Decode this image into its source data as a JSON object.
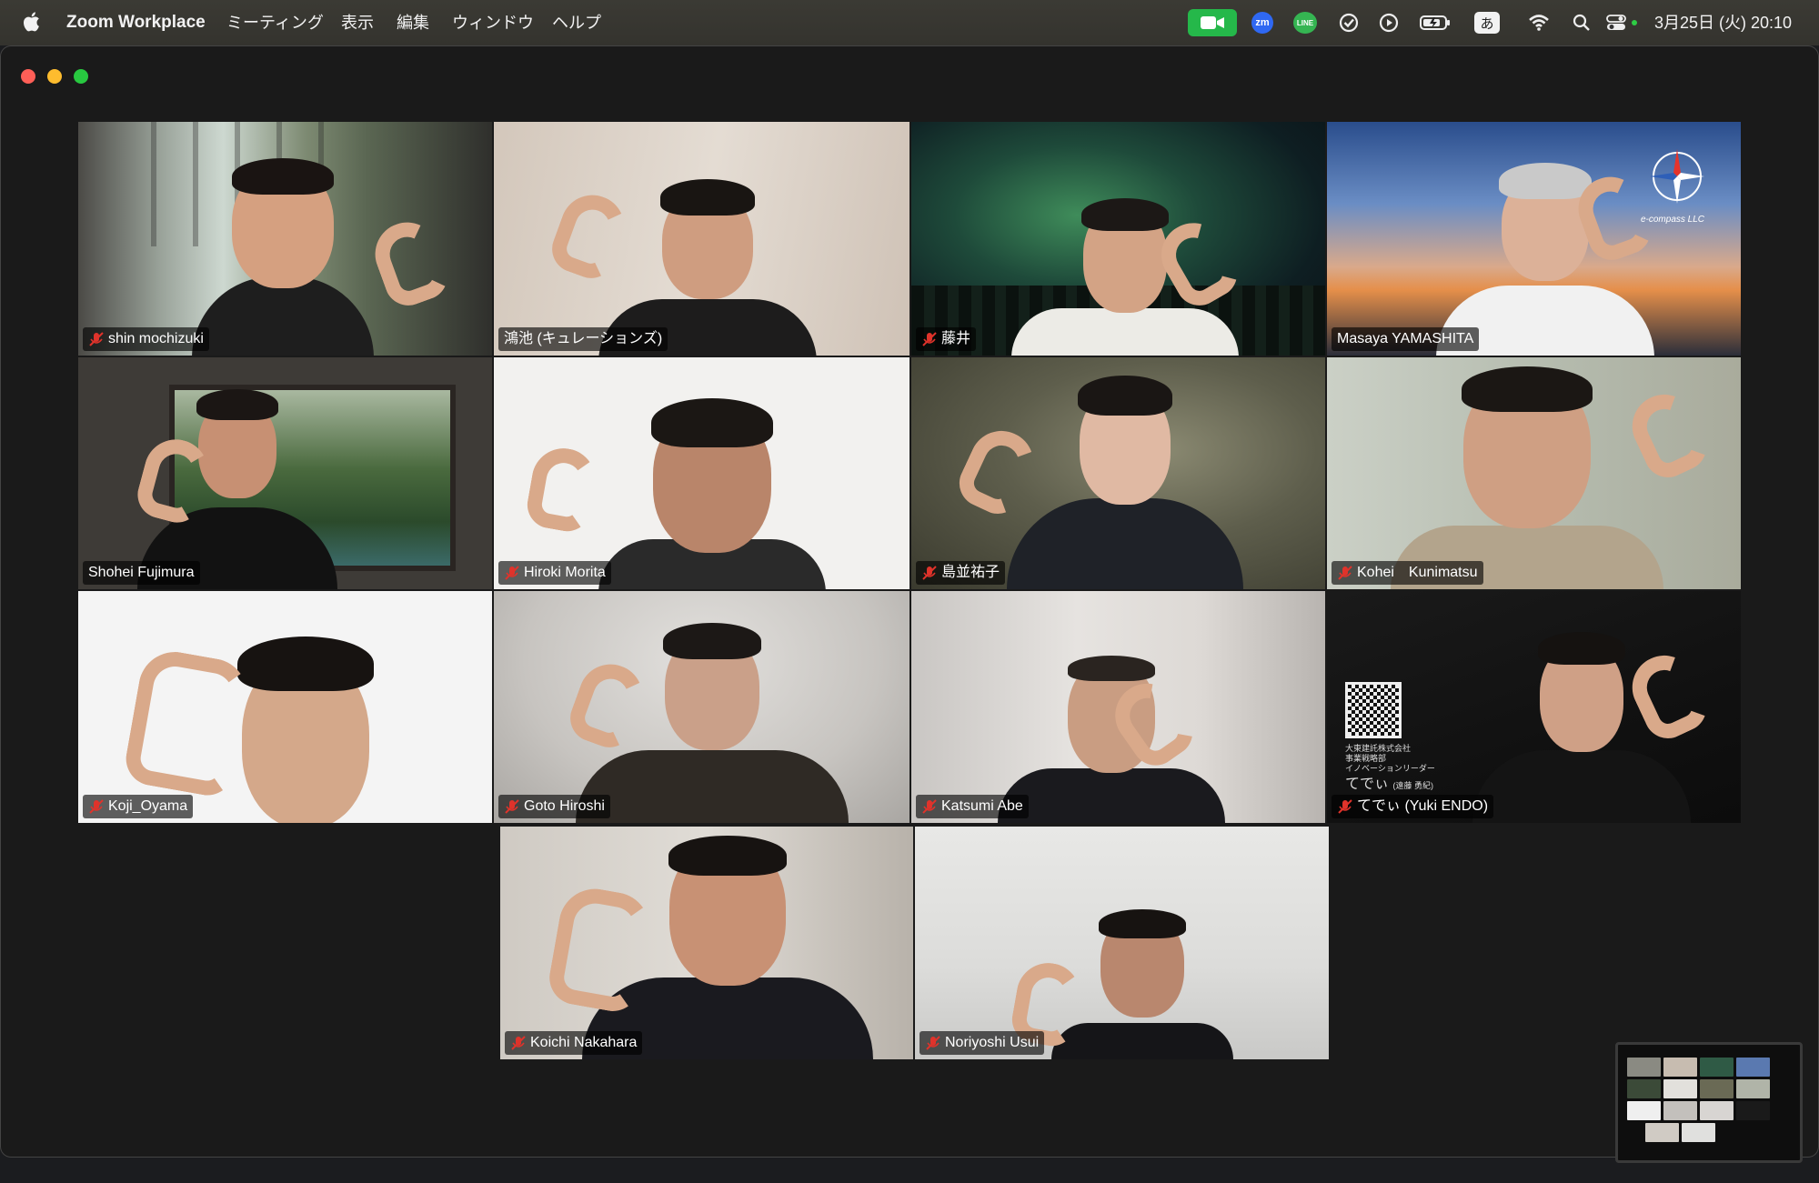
{
  "menubar": {
    "app_name": "Zoom Workplace",
    "menus": [
      "ミーティング",
      "表示",
      "編集",
      "ウィンドウ",
      "ヘルプ"
    ],
    "clock": "3月25日 (火)  20:10",
    "ime_label": "あ",
    "zm_label": "zm",
    "line_label": "LINE",
    "icons": [
      "apple-icon",
      "zoom-video-indicator-icon",
      "zoom-app-icon",
      "line-app-icon",
      "check-icon",
      "play-icon",
      "battery-icon",
      "ime-icon",
      "wifi-icon",
      "search-icon",
      "control-center-icon"
    ]
  },
  "window": {
    "buttons": [
      "close",
      "minimize",
      "maximize"
    ]
  },
  "participants": [
    {
      "name": "shin mochizuki",
      "muted": true
    },
    {
      "name": "鴻池 (キュレーションズ)",
      "muted": false,
      "active_speaker": true
    },
    {
      "name": "藤井",
      "muted": true
    },
    {
      "name": "Masaya YAMASHITA",
      "muted": false
    },
    {
      "name": "Shohei Fujimura",
      "muted": false
    },
    {
      "name": "Hiroki Morita",
      "muted": true
    },
    {
      "name": "島並祐子",
      "muted": true
    },
    {
      "name": "Kohei　Kunimatsu",
      "muted": true
    },
    {
      "name": "Koji_Oyama",
      "muted": true
    },
    {
      "name": "Goto Hiroshi",
      "muted": true
    },
    {
      "name": "Katsumi Abe",
      "muted": true
    },
    {
      "name": "てでぃ (Yuki ENDO)",
      "muted": true
    },
    {
      "name": "Koichi Nakahara",
      "muted": true
    },
    {
      "name": "Noriyoshi Usui",
      "muted": true
    }
  ],
  "overlay_text": {
    "compass_brand": "e-compass LLC",
    "endo_company": "大東建託株式会社",
    "endo_dept": "事業戦略部",
    "endo_role": "イノベーションリーダー",
    "endo_nick": "てでぃ",
    "endo_name": "(遠藤 勇紀)"
  },
  "colors": {
    "active_border": "#2ecc44",
    "mute_red": "#e0332b",
    "menubar_bg": "#36352f",
    "window_bg": "#1a1a1a"
  }
}
